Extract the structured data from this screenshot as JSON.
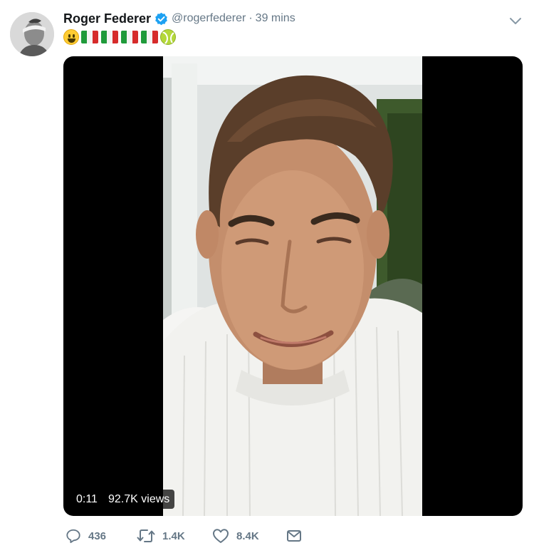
{
  "tweet": {
    "author": {
      "display_name": "Roger Federer",
      "verified": true,
      "handle": "@rogerfederer",
      "avatar_icon": "avatar-photo"
    },
    "separator": "·",
    "timestamp": "39 mins",
    "text_emojis": [
      "grinning-face-emoji",
      "flag-italy",
      "flag-italy",
      "flag-italy",
      "flag-italy",
      "tennis-ball-emoji"
    ],
    "video": {
      "duration": "0:11",
      "views": "92.7K views"
    },
    "actions": {
      "reply_count": "436",
      "retweet_count": "1.4K",
      "like_count": "8.4K"
    },
    "colors": {
      "verified_blue": "#1da1f2",
      "muted_text": "#657786",
      "primary_text": "#14171a"
    }
  }
}
